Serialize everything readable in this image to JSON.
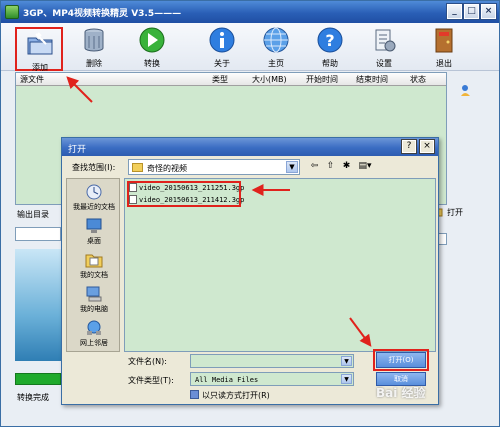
{
  "window": {
    "title": "3GP、MP4视频转换精灵 V3.5———"
  },
  "toolbar": {
    "add": "添加",
    "delete": "删除",
    "convert": "转换",
    "about": "关于",
    "home": "主页",
    "help": "帮助",
    "settings": "设置",
    "exit": "退出"
  },
  "filelist": {
    "columns": [
      "源文件",
      "类型",
      "大小(MB)",
      "开始时间",
      "结束时间",
      "状态"
    ]
  },
  "main": {
    "output_dir_label": "输出目录",
    "status": "转换完成",
    "open_label": "打开"
  },
  "dialog": {
    "title": "打开",
    "look_in_label": "查找范围(I):",
    "look_in_value": "奇怪的视频",
    "places": [
      "我最近的文档",
      "桌面",
      "我的文档",
      "我的电脑",
      "网上邻居"
    ],
    "files": [
      "video_20150613_211251.3gp",
      "video_20150613_211412.3gp"
    ],
    "filename_label": "文件名(N):",
    "filename_value": "",
    "filetype_label": "文件类型(T):",
    "filetype_value": "All Media Files",
    "readonly_label": "以只读方式打开(R)",
    "open_button": "打开(O)",
    "cancel_button": "取消"
  },
  "watermark": "Bai 经验"
}
